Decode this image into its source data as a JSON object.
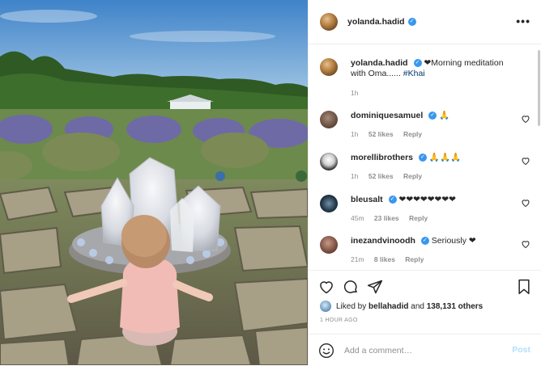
{
  "post": {
    "author": "yolanda.hadid",
    "verified_icon": "verified-badge-icon"
  },
  "caption": {
    "user": "yolanda.hadid",
    "text": "❤Morning meditation with Oma...... ",
    "hashtag": "#Khai",
    "time": "1h"
  },
  "comments": [
    {
      "user": "dominiquesamuel",
      "text": "🙏",
      "time": "1h",
      "likes": "52 likes",
      "reply": "Reply"
    },
    {
      "user": "morellibrothers",
      "text": "🙏🙏🙏",
      "time": "1h",
      "likes": "52 likes",
      "reply": "Reply"
    },
    {
      "user": "bleusalt",
      "text": "❤❤❤❤❤❤❤❤",
      "time": "45m",
      "likes": "23 likes",
      "reply": "Reply"
    },
    {
      "user": "inezandvinoodh",
      "text": "Seriously ❤",
      "time": "21m",
      "likes": "8 likes",
      "reply": "Reply"
    }
  ],
  "likes": {
    "prefix": "Liked by ",
    "first_user": "bellahadid",
    "connector": " and ",
    "others": "138,131 others"
  },
  "timestamp": "1 HOUR AGO",
  "add_comment": {
    "placeholder": "Add a comment…",
    "post_label": "Post"
  },
  "colors": {
    "verified": "#3897f0",
    "hashtag": "#00376b",
    "post_button_disabled": "#b2dffc",
    "meta_gray": "#8e8e8e"
  }
}
